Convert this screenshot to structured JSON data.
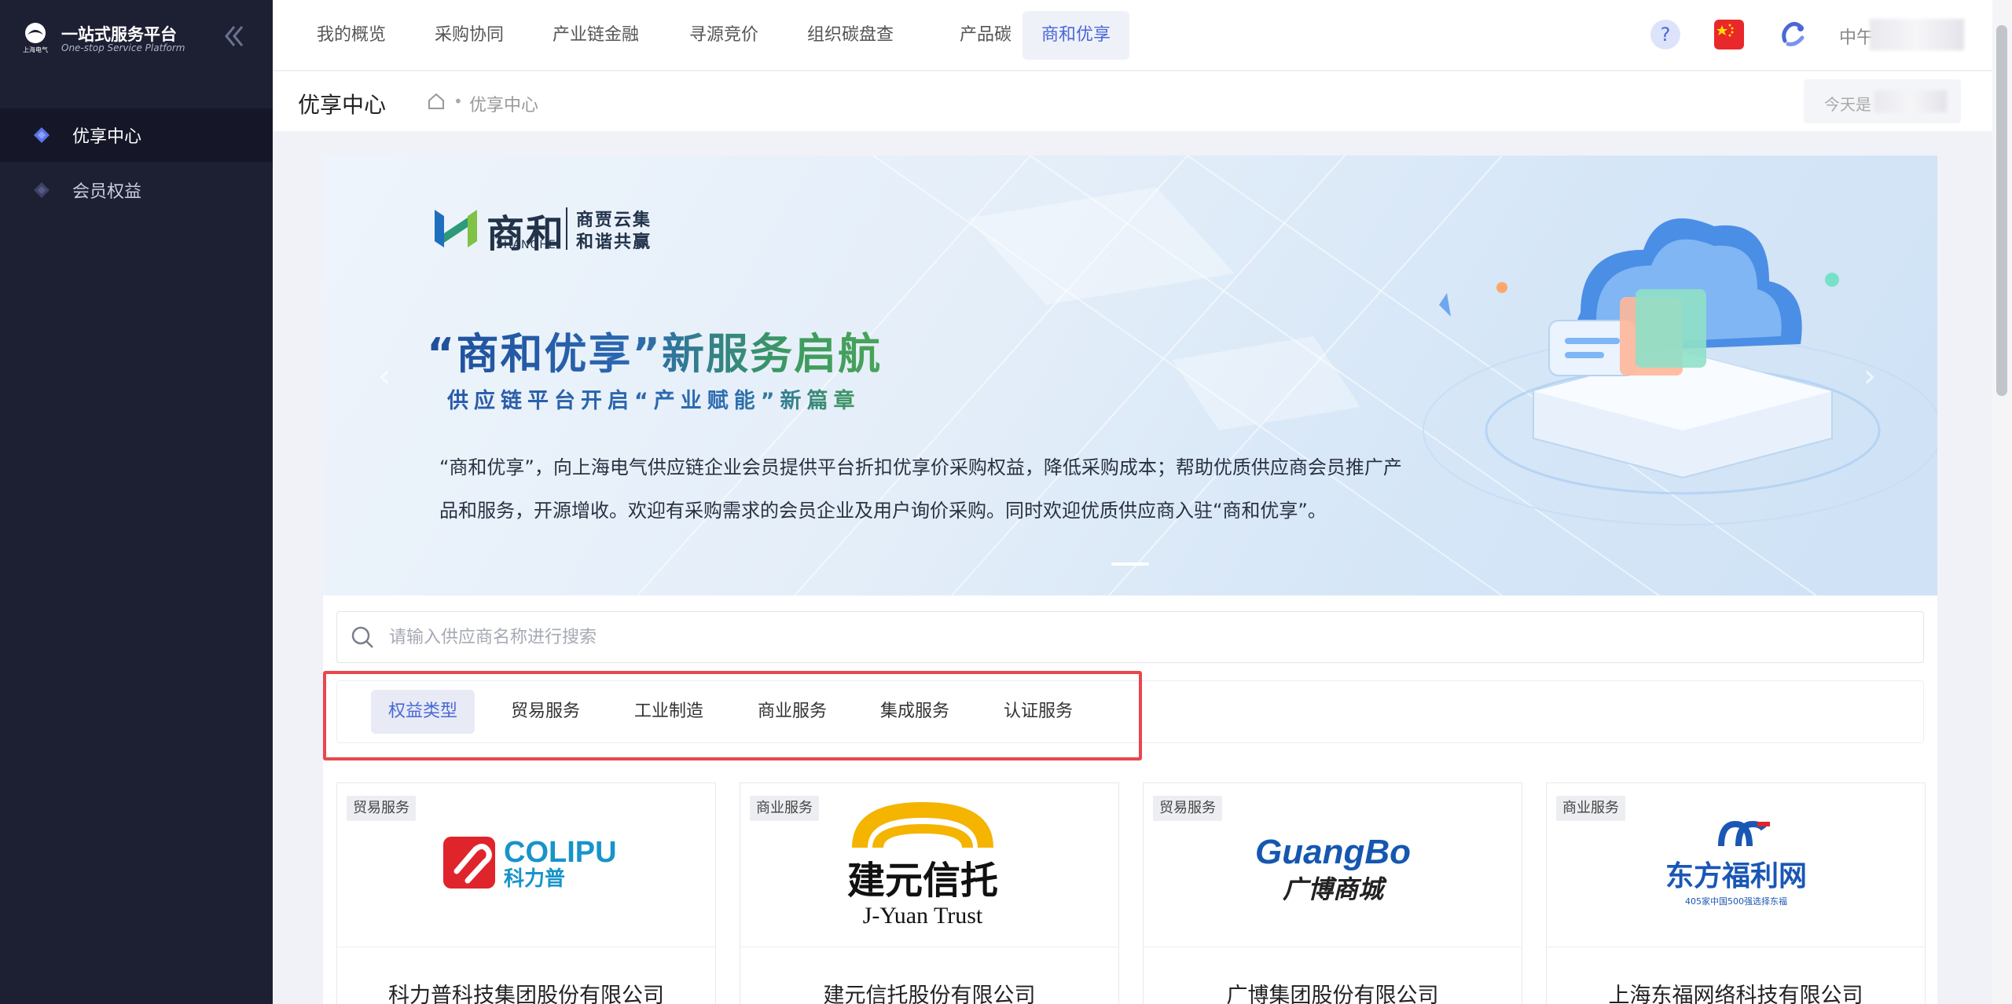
{
  "app": {
    "title": "一站式服务平台",
    "subtitle": "One-stop Service Platform",
    "logo_caption": "上海电气"
  },
  "sidebar": {
    "items": [
      {
        "label": "优享中心",
        "icon": "diamond-icon",
        "active": true
      },
      {
        "label": "会员权益",
        "icon": "diamond-icon",
        "active": false
      }
    ]
  },
  "topnav": {
    "items": [
      {
        "label": "我的概览",
        "active": false
      },
      {
        "label": "采购协同",
        "active": false
      },
      {
        "label": "产业链金融",
        "active": false
      },
      {
        "label": "寻源竞价",
        "active": false
      },
      {
        "label": "组织碳盘查",
        "active": false
      },
      {
        "label": "产品碳",
        "active": false
      },
      {
        "label": "商和优享",
        "active": true
      }
    ],
    "user_greeting": "中午"
  },
  "page": {
    "title": "优享中心",
    "breadcrumb": "优享中心",
    "today_label": "今天是"
  },
  "banner": {
    "brand_cn": "商和",
    "brand_en": "SHANGHE",
    "slogan_line1": "商贾云集",
    "slogan_line2": "和谐共赢",
    "headline": "“商和优享”新服务启航",
    "subhead": "供应链平台开启“产业赋能”新篇章",
    "description": "“商和优享”，向上海电气供应链企业会员提供平台折扣优享价采购权益，降低采购成本；帮助优质供应商会员推广产品和服务，开源增收。欢迎有采购需求的会员企业及用户询价采购。同时欢迎优质供应商入驻“商和优享”。"
  },
  "search": {
    "placeholder": "请输入供应商名称进行搜索",
    "value": ""
  },
  "filters": {
    "tabs": [
      {
        "label": "权益类型",
        "active": true
      },
      {
        "label": "贸易服务",
        "active": false
      },
      {
        "label": "工业制造",
        "active": false
      },
      {
        "label": "商业服务",
        "active": false
      },
      {
        "label": "集成服务",
        "active": false
      },
      {
        "label": "认证服务",
        "active": false
      }
    ]
  },
  "cards": [
    {
      "tag": "贸易服务",
      "name": "科力普科技集团股份有限公司",
      "logo_text": "COLIPU",
      "logo_sub": "科力普"
    },
    {
      "tag": "商业服务",
      "name": "建元信托股份有限公司",
      "logo_text": "建元信托",
      "logo_sub": "J-Yuan Trust"
    },
    {
      "tag": "贸易服务",
      "name": "广博集团股份有限公司",
      "logo_text": "GuangBo",
      "logo_sub": "广博商城"
    },
    {
      "tag": "商业服务",
      "name": "上海东福网络科技有限公司",
      "logo_text": "东方福利网",
      "logo_sub": "405家中国500强选择东福"
    }
  ],
  "colors": {
    "sidebar_bg": "#1d1f33",
    "accent": "#4a68d6",
    "highlight_border": "#e8474c"
  }
}
